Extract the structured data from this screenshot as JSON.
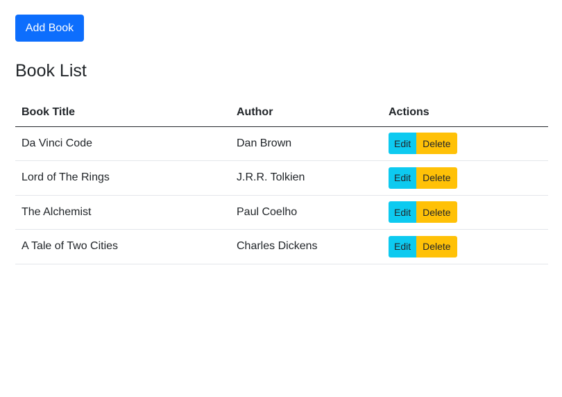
{
  "toolbar": {
    "add_label": "Add Book"
  },
  "page": {
    "title": "Book List"
  },
  "table": {
    "headers": [
      "Book Title",
      "Author",
      "Actions"
    ],
    "rows": [
      {
        "title": "Da Vinci Code",
        "author": "Dan Brown",
        "edit_label": "Edit",
        "delete_label": "Delete"
      },
      {
        "title": "Lord of The Rings",
        "author": "J.R.R. Tolkien",
        "edit_label": "Edit",
        "delete_label": "Delete"
      },
      {
        "title": "The Alchemist",
        "author": "Paul Coelho",
        "edit_label": "Edit",
        "delete_label": "Delete"
      },
      {
        "title": "A Tale of Two Cities",
        "author": "Charles Dickens",
        "edit_label": "Edit",
        "delete_label": "Delete"
      }
    ]
  },
  "colors": {
    "primary": "#0d6efd",
    "info": "#0dcaf0",
    "warning": "#ffc107"
  }
}
